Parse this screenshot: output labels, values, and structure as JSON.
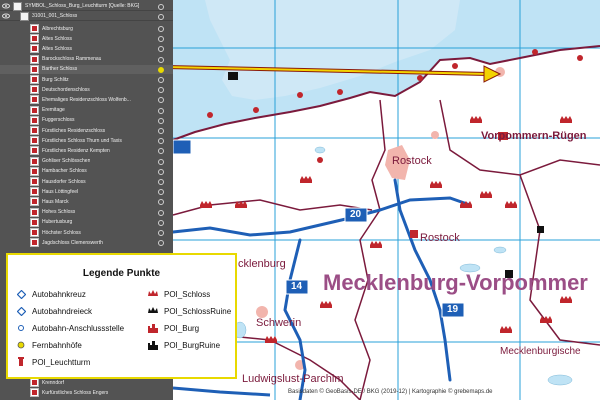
{
  "panel": {
    "layers": [
      {
        "name": "SYMBOL_Schloss_Burg_Leuchtturm [Quelle: BKG]"
      },
      {
        "name": "31001_001_Schloss"
      }
    ],
    "items": [
      "Albrechtsburg",
      "Altes Schloss",
      "Altes Schloss",
      "Barockschloss Rammenau",
      "Barther Schloss",
      "Burg Schlitz",
      "Deutschordenschloss",
      "Ehemaliges Residenzschloss Wolfenb...",
      "Eremitage",
      "Fuggerschloss",
      "Fürstliches Residenzschloss",
      "Fürstliches Schloss Thurn und Taxis",
      "Fürstliches Residenz Kempten",
      "Gohliser Schlösschen",
      "Hambacher Schloss",
      "Hausdorfer Schloss",
      "Haus Löttingfeel",
      "Haus Marck",
      "Hohes Schloss",
      "Hubertusburg",
      "Höchster Schloss",
      "Jagdschloss Clemenswerth"
    ],
    "bottom_items": [
      "Krenndorf",
      "Kurfürstliches Schloss Engers"
    ]
  },
  "map": {
    "labels": {
      "vorpommern_ruegen": "Vorpommern-Rügen",
      "rostock_city": "Rostock",
      "rostock_district": "Rostock",
      "mecklenburg_partial": "cklenburg",
      "mecklenburg_vorpommern": "Mecklenburg-Vorpommer",
      "schwerin": "Schwerin",
      "ludwigslust": "Ludwigslust-Parchim",
      "mecklenburgische": "Mecklenburgische"
    },
    "shields": {
      "a20": "20",
      "a14": "14",
      "a19": "19"
    },
    "footer": "Basisdaten © GeoBasis-DE / BKG (2019-12)  |  Kartographie © grebemaps.de"
  },
  "legend": {
    "title": "Legende Punkte",
    "left": [
      {
        "label": "Autobahnkreuz",
        "icon": "diamond-icon"
      },
      {
        "label": "Autobahndreieck",
        "icon": "diamond-icon"
      },
      {
        "label": "Autobahn-Anschlussstelle",
        "icon": "small-circle-icon"
      },
      {
        "label": "Fernbahnhöfe",
        "icon": "yellow-dot-icon"
      },
      {
        "label": "POI_Leuchtturm",
        "icon": "lighthouse-icon"
      }
    ],
    "right": [
      {
        "label": "POI_Schloss",
        "icon": "crown-icon"
      },
      {
        "label": "POI_SchlossRuine",
        "icon": "crown-ruin-icon"
      },
      {
        "label": "POI_Burg",
        "icon": "castle-icon"
      },
      {
        "label": "POI_BurgRuine",
        "icon": "castle-ruin-icon"
      }
    ]
  },
  "colors": {
    "panel": "#535353",
    "sea": "#bfe3f5",
    "border": "#7b1a3c",
    "autobahn": "#1e5fb6",
    "poi": "#c0262c",
    "highlight": "#e8d900"
  }
}
